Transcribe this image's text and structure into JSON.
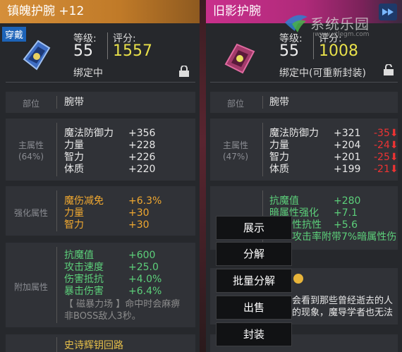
{
  "left": {
    "title": "镇魄护腕 +12",
    "equipped_tag": "穿戴",
    "level_label": "等级:",
    "level": "55",
    "score_label": "评分:",
    "score": "1557",
    "bind_text": "绑定中",
    "slot_label": "部位",
    "slot_value": "腕带",
    "main_label": "主属性",
    "main_pct": "(64%)",
    "main_attrs": [
      {
        "name": "魔法防御力",
        "val": "+356"
      },
      {
        "name": "力量",
        "val": "+228"
      },
      {
        "name": "智力",
        "val": "+226"
      },
      {
        "name": "体质",
        "val": "+220"
      }
    ],
    "enh_label": "强化属性",
    "enh_attrs": [
      {
        "name": "魔伤减免",
        "val": "+6.3%"
      },
      {
        "name": "力量",
        "val": "+30"
      },
      {
        "name": "智力",
        "val": "+30"
      }
    ],
    "extra_label": "附加属性",
    "extra_attrs": [
      {
        "name": "抗魔值",
        "val": "+600"
      },
      {
        "name": "攻击速度",
        "val": "+25.0"
      },
      {
        "name": "伤害抵抗",
        "val": "+4.0%"
      },
      {
        "name": "暴击伤害",
        "val": "+6.4%"
      }
    ],
    "extra_note_1": "【 磁暴力场 】命中时会麻痹",
    "extra_note_2": "非BOSS敌人3秒。",
    "bottom_text": "史诗辉钥回路"
  },
  "right": {
    "title": "旧影护腕",
    "level_label": "等级:",
    "level": "55",
    "score_label": "评分:",
    "score": "1008",
    "bind_text": "绑定中(可重新封装)",
    "slot_label": "部位",
    "slot_value": "腕带",
    "main_label": "主属性",
    "main_pct": "(47%)",
    "main_attrs": [
      {
        "name": "魔法防御力",
        "val": "+321",
        "diff": "-35"
      },
      {
        "name": "力量",
        "val": "+204",
        "diff": "-24"
      },
      {
        "name": "智力",
        "val": "+201",
        "diff": "-25"
      },
      {
        "name": "体质",
        "val": "+199",
        "diff": "-21"
      }
    ],
    "extra_attrs": [
      {
        "name": "抗魔值",
        "val": "+280"
      },
      {
        "name": "暗属性强化",
        "val": "+7.1"
      },
      {
        "name": "性抗性",
        "val": "+5.6"
      }
    ],
    "extra_note": "攻击率附带7%暗属性伤",
    "lore_1": "会看到那些曾经逝去的人",
    "lore_2": "的现象，魔导学者也无法"
  },
  "menu": [
    "展示",
    "分解",
    "批量分解",
    "出售",
    "封装"
  ],
  "watermark": {
    "text": "系统乐园",
    "url": "www.xtlegm.com"
  },
  "colors": {
    "left_title": "#d58f3a",
    "right_title": "#c9308c",
    "score": "#e8e04a",
    "green": "#5ccf7a",
    "orange": "#f0a830",
    "red": "#e33333"
  }
}
